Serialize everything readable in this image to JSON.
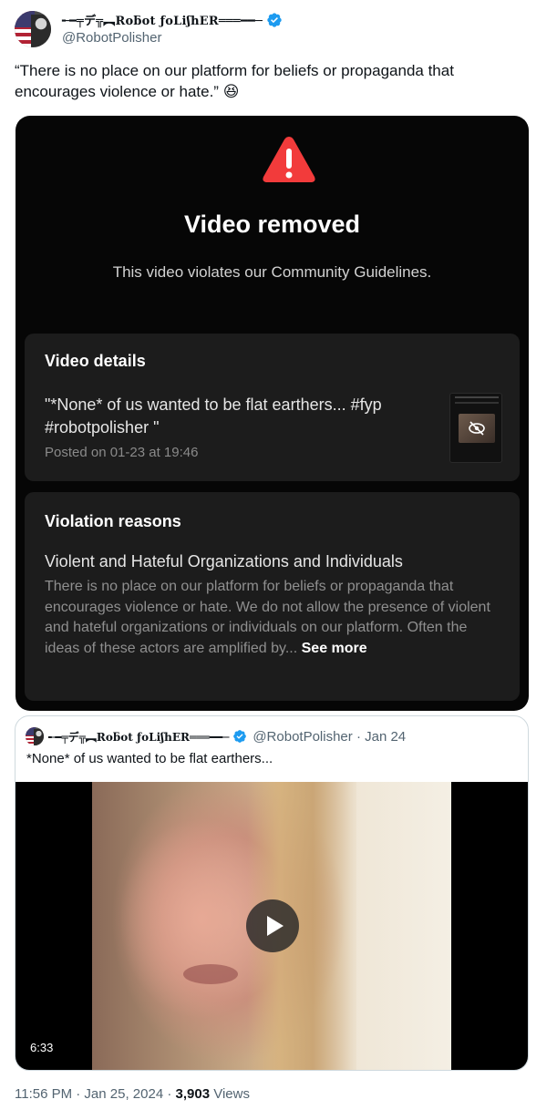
{
  "author": {
    "display_name": "╾━╤デ╦︻Roƃot ƒoLiʃhER═══━━─",
    "handle": "@RobotPolisher",
    "avatar_icon": "avatar-flag-figure",
    "verified_icon": "verified-badge-icon",
    "verified_color": "#1d9bf0"
  },
  "tweet": {
    "text": "“There is no place on our platform for beliefs or propaganda that encourages violence or hate.” 😆"
  },
  "media": {
    "warning_icon": "warning-triangle-icon",
    "warning_color": "#f23b3b",
    "title": "Video removed",
    "subtitle": "This video violates our Community Guidelines.",
    "details": {
      "heading": "Video details",
      "caption": "\"*None* of us wanted to be flat earthers... #fyp #robotpolisher \"",
      "posted": "Posted on 01-23 at 19:46",
      "thumbnail_icon": "hidden-eye-icon"
    },
    "violation": {
      "heading": "Violation reasons",
      "reason": "Violent and Hateful Organizations and Individuals",
      "body": "There is no place on our platform for beliefs or propaganda that encourages violence or hate. We do not allow the presence of violent and hateful organizations or individuals on our platform. Often the ideas of these actors are amplified by...",
      "see_more": " See more"
    }
  },
  "quoted": {
    "display_name": "╾━╤デ╦︻Roƃot ƒoLiʃhER═══━━─",
    "handle_date": "@RobotPolisher · Jan 24",
    "text": "*None* of us wanted to be flat earthers...",
    "video_duration": "6:33",
    "play_icon": "play-icon"
  },
  "footer": {
    "time_date": "11:56 PM · Jan 25, 2024 · ",
    "views_count": "3,903",
    "views_label": " Views"
  }
}
